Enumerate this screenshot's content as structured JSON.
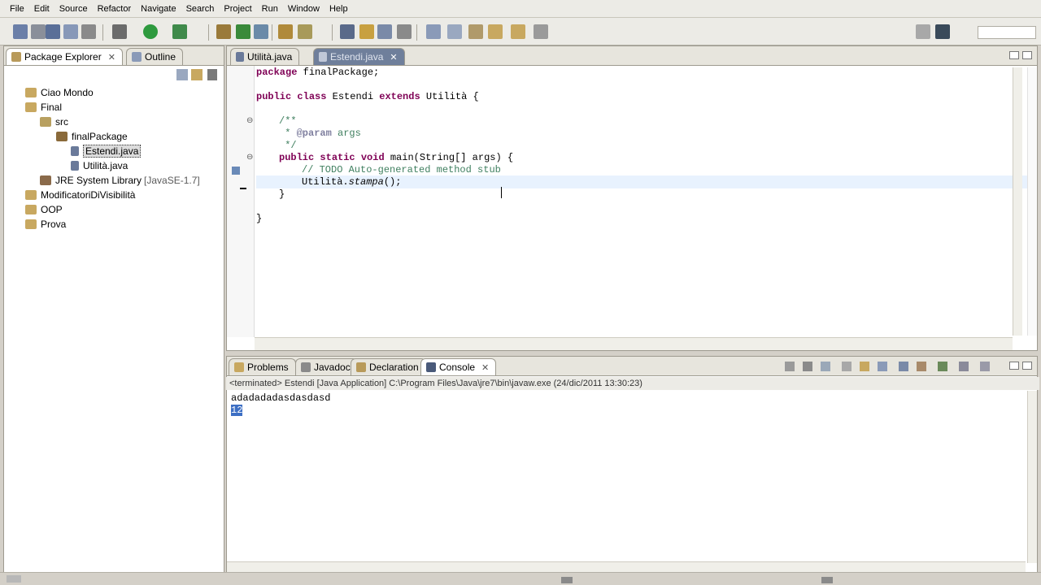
{
  "menubar": {
    "items": [
      "File",
      "Edit",
      "Source",
      "Refactor",
      "Navigate",
      "Search",
      "Project",
      "Run",
      "Window",
      "Help"
    ]
  },
  "left_panel": {
    "tabs": [
      {
        "label": "Package Explorer",
        "close": "✕"
      },
      {
        "label": "Outline",
        "close": ""
      }
    ],
    "tree": [
      {
        "label": "Ciao Mondo",
        "level": 0,
        "icon": "project-icon"
      },
      {
        "label": "Final",
        "level": 0,
        "icon": "project-icon"
      },
      {
        "label": "src",
        "level": 1,
        "icon": "source-folder-icon"
      },
      {
        "label": "finalPackage",
        "level": 2,
        "icon": "package-icon"
      },
      {
        "label": "Estendi.java",
        "level": 3,
        "icon": "java-file-icon",
        "selected": true
      },
      {
        "label": "Utilità.java",
        "level": 3,
        "icon": "java-file-icon"
      },
      {
        "label": "JRE System Library",
        "suffix": "[JavaSE-1.7]",
        "level": 1,
        "icon": "library-icon"
      },
      {
        "label": "ModificatoriDiVisibilità",
        "level": 0,
        "icon": "project-icon"
      },
      {
        "label": "OOP",
        "level": 0,
        "icon": "project-icon"
      },
      {
        "label": "Prova",
        "level": 0,
        "icon": "project-icon"
      }
    ]
  },
  "editor": {
    "tabs": [
      {
        "label": "Utilità.java",
        "active": false
      },
      {
        "label": "Estendi.java",
        "active": true,
        "close": "✕"
      }
    ],
    "code": {
      "l1_kw": "package",
      "l1_rest": " finalPackage;",
      "l2_kw1": "public",
      "l2_kw2": "class",
      "l2_name": " Estendi ",
      "l2_kw3": "extends",
      "l2_rest": " Utilità {",
      "l3": "/**",
      "l4_pre": " * ",
      "l4_tag": "@param",
      "l4_rest": " args",
      "l5": " */",
      "l6_kw1": "public",
      "l6_kw2": "static",
      "l6_kw3": "void",
      "l6_rest": " main(String[] args) {",
      "l7": "// TODO Auto-generated method stub",
      "l8_pre": "Utilità.",
      "l8_it": "stampa",
      "l8_rest": "();",
      "l9": "}",
      "l10": "}"
    }
  },
  "bottom_panel": {
    "tabs": [
      {
        "label": "Problems"
      },
      {
        "label": "Javadoc"
      },
      {
        "label": "Declaration"
      },
      {
        "label": "Console",
        "active": true,
        "close": "✕"
      }
    ],
    "console_header": "<terminated> Estendi [Java Application] C:\\Program Files\\Java\\jre7\\bin\\javaw.exe (24/dic/2011 13:30:23)",
    "output": [
      "adadadadasdasdasd",
      "12"
    ]
  },
  "colors": {
    "keyword": "#7f0055",
    "comment": "#3f7f5f",
    "selection": "#3d6fc4",
    "dark_tab": "#6f7f9b"
  }
}
